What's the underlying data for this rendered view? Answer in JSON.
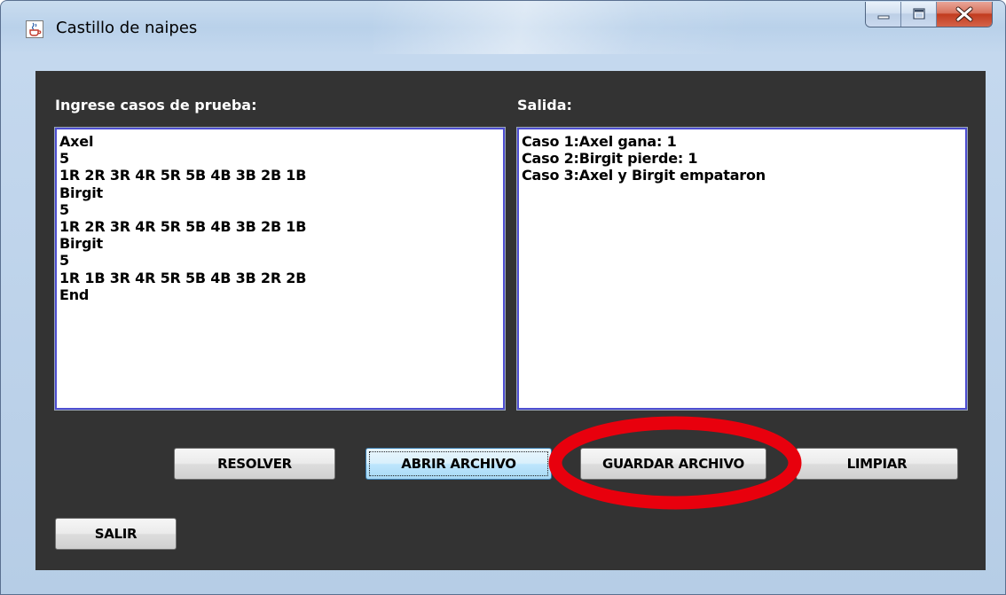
{
  "window": {
    "title": "Castillo de naipes",
    "app_icon": "java-cup-icon",
    "caption_buttons": [
      "minimize-icon",
      "maximize-icon",
      "close-icon"
    ]
  },
  "input_panel": {
    "label": "Ingrese casos de prueba:",
    "lines": [
      "Axel",
      "5",
      "1R 2R 3R 4R 5R 5B 4B 3B 2B 1B",
      "Birgit",
      "5",
      "1R 2R 3R 4R 5R 5B 4B 3B 2B 1B",
      "Birgit",
      "5",
      "1R 1B 3R 4R 5R 5B 4B 3B 2R 2B",
      "End"
    ]
  },
  "output_panel": {
    "label": "Salida:",
    "lines": [
      "Caso 1:Axel gana: 1",
      "Caso 2:Birgit pierde: 1",
      "Caso 3:Axel y Birgit empataron"
    ]
  },
  "buttons": {
    "resolver": "RESOLVER",
    "abrir": "ABRIR ARCHIVO",
    "guardar": "GUARDAR ARCHIVO",
    "limpiar": "LIMPIAR",
    "salir": "SALIR"
  },
  "colors": {
    "panel_background": "#333333",
    "text_area_border": "#4d4dd0",
    "annotation_ellipse": "#e8000d"
  }
}
